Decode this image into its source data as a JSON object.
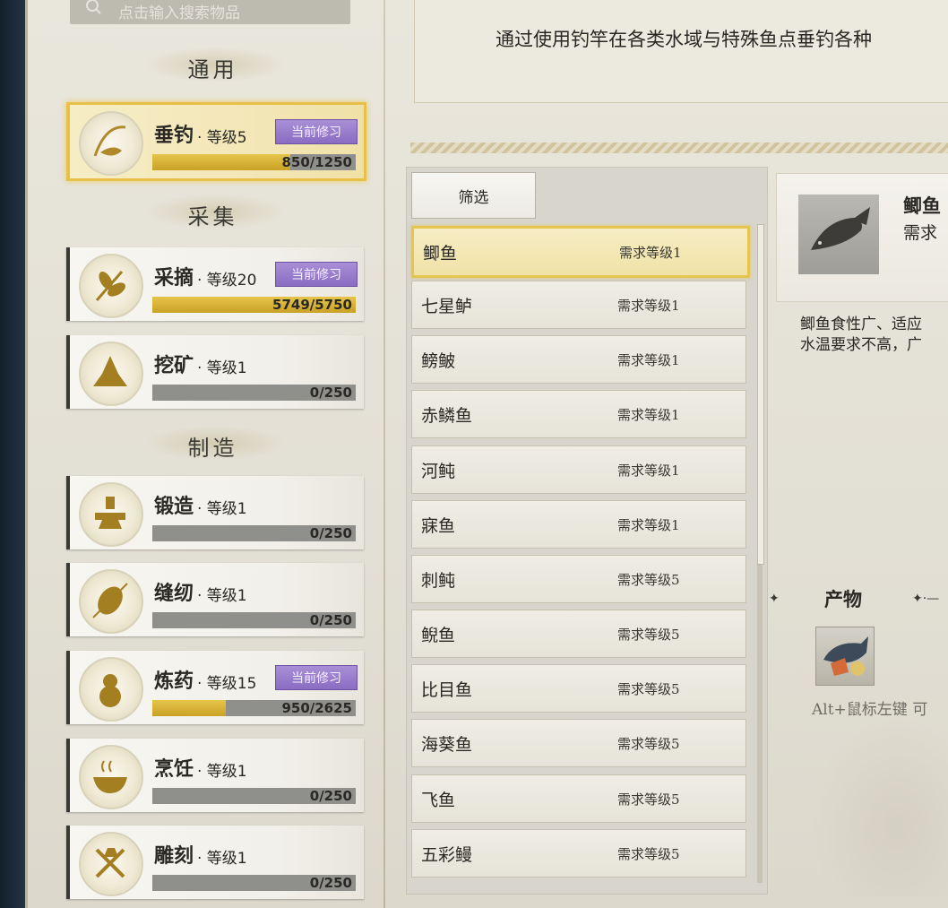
{
  "search": {
    "placeholder": "点击输入搜索物品"
  },
  "categories": [
    {
      "title": "通用"
    },
    {
      "title": "采集"
    },
    {
      "title": "制造"
    }
  ],
  "skills": [
    {
      "name": "垂钓",
      "level": "· 等级5",
      "badge": "当前修习",
      "progress_text": "850/1250",
      "progress": 0.68,
      "active": true
    },
    {
      "name": "采摘",
      "level": "· 等级20",
      "badge": "当前修习",
      "progress_text": "5749/5750",
      "progress": 0.9998
    },
    {
      "name": "挖矿",
      "level": "· 等级1",
      "badge": "",
      "progress_text": "0/250",
      "progress": 0
    },
    {
      "name": "锻造",
      "level": "· 等级1",
      "badge": "",
      "progress_text": "0/250",
      "progress": 0
    },
    {
      "name": "缝纫",
      "level": "· 等级1",
      "badge": "",
      "progress_text": "0/250",
      "progress": 0
    },
    {
      "name": "炼药",
      "level": "· 等级15",
      "badge": "当前修习",
      "progress_text": "950/2625",
      "progress": 0.362
    },
    {
      "name": "烹饪",
      "level": "· 等级1",
      "badge": "",
      "progress_text": "0/250",
      "progress": 0
    },
    {
      "name": "雕刻",
      "level": "· 等级1",
      "badge": "",
      "progress_text": "0/250",
      "progress": 0
    }
  ],
  "description": "通过使用钓竿在各类水域与特殊鱼点垂钓各种",
  "filter_label": "筛选",
  "fish": [
    {
      "name": "鲫鱼",
      "req": "需求等级1"
    },
    {
      "name": "七星鲈",
      "req": "需求等级1"
    },
    {
      "name": "鳑鲏",
      "req": "需求等级1"
    },
    {
      "name": "赤鳞鱼",
      "req": "需求等级1"
    },
    {
      "name": "河鲀",
      "req": "需求等级1"
    },
    {
      "name": "寐鱼",
      "req": "需求等级1"
    },
    {
      "name": "刺鲀",
      "req": "需求等级5"
    },
    {
      "name": "鲵鱼",
      "req": "需求等级5"
    },
    {
      "name": "比目鱼",
      "req": "需求等级5"
    },
    {
      "name": "海葵鱼",
      "req": "需求等级5"
    },
    {
      "name": "飞鱼",
      "req": "需求等级5"
    },
    {
      "name": "五彩鳗",
      "req": "需求等级5"
    }
  ],
  "detail": {
    "name": "鲫鱼",
    "req": "需求",
    "desc_line1": "鲫鱼食性广、适应",
    "desc_line2": "水温要求不高，广",
    "product_title": "产物",
    "hint": "Alt+鼠标左键 可"
  },
  "colors": {
    "gold": "#e6c44a",
    "badge": "#9a7dcc"
  }
}
